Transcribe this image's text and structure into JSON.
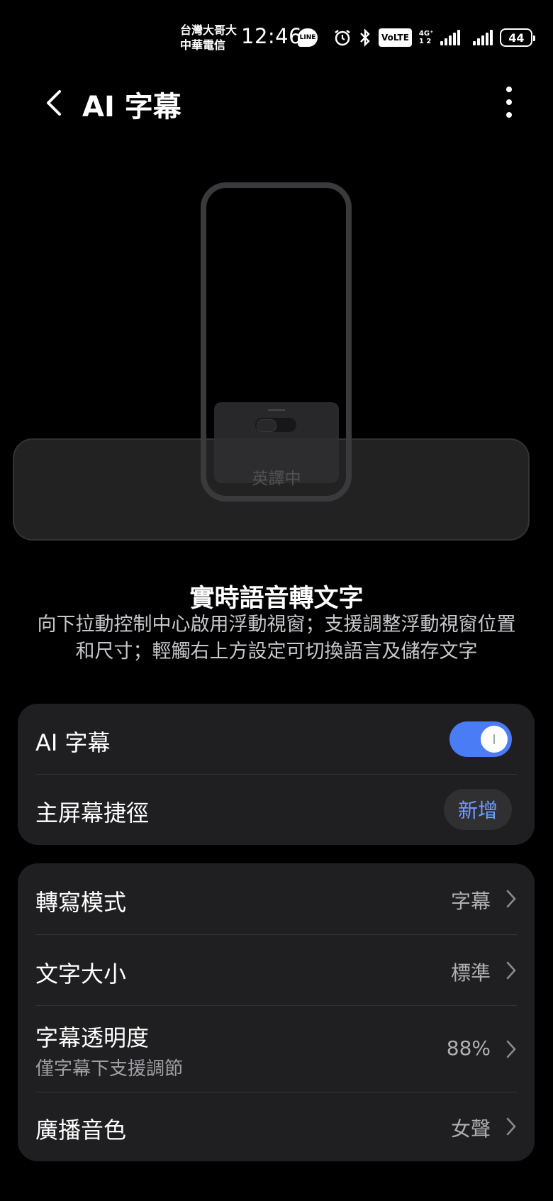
{
  "status_bar": {
    "carrier_1": "台灣大哥大",
    "carrier_2": "中華電信",
    "time": "12:46",
    "line_badge": "LINE",
    "icons": [
      "alarm-icon",
      "bluetooth-icon",
      "volte-icon",
      "signal-icon",
      "signal-icon-2",
      "battery-icon"
    ],
    "volte": "VoLTE",
    "network_type": "4G⁺",
    "sim_numbers": "1 2",
    "battery": "44"
  },
  "header": {
    "title": "AI 字幕"
  },
  "illustration": {
    "card_label": "英譯中"
  },
  "description": {
    "title": "實時語音轉文字",
    "body": "向下拉動控制中心啟用浮動視窗；支援調整浮動視窗位置和尺寸；輕觸右上方設定可切換語言及儲存文字"
  },
  "settings_group_1": {
    "ai_subtitle_label": "AI 字幕",
    "ai_subtitle_enabled": true,
    "shortcut_label": "主屏幕捷徑",
    "shortcut_button": "新增"
  },
  "settings_group_2": {
    "items": [
      {
        "label": "轉寫模式",
        "value": "字幕",
        "sub": ""
      },
      {
        "label": "文字大小",
        "value": "標準",
        "sub": ""
      },
      {
        "label": "字幕透明度",
        "value": "88%",
        "sub": "僅字幕下支援調節"
      },
      {
        "label": "廣播音色",
        "value": "女聲",
        "sub": ""
      }
    ]
  },
  "colors": {
    "background": "#000000",
    "card": "#1f1f21",
    "accent": "#4a7cf6",
    "link": "#6f9cff"
  }
}
